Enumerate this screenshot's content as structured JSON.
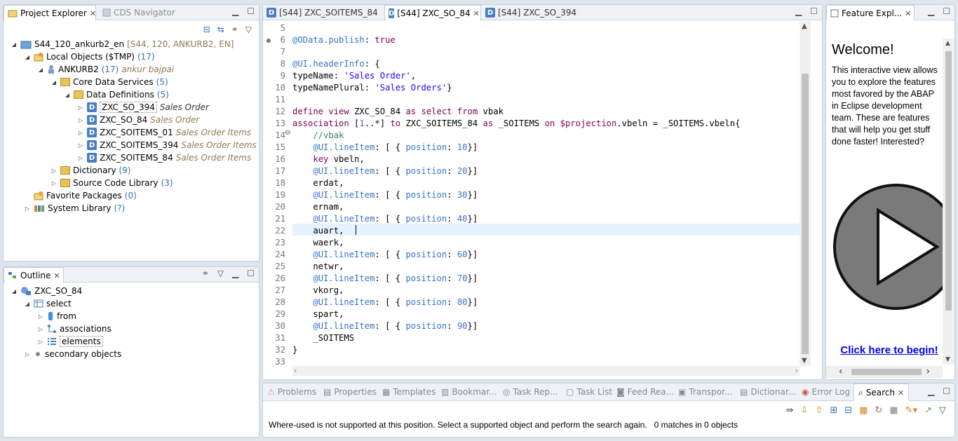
{
  "project_explorer": {
    "tabs": [
      {
        "label": "Project Explorer"
      },
      {
        "label": "CDS Navigator"
      }
    ],
    "tree": [
      {
        "label": "S44_120_ankurb2_en",
        "count": "[S44, 120, ANKURB2, EN]",
        "desc": ""
      },
      {
        "label": "Local Objects ($TMP)",
        "count": "(17)",
        "desc": ""
      },
      {
        "label": "ANKURB2",
        "count": "(17)",
        "desc": "ankur bajpai"
      },
      {
        "label": "Core Data Services",
        "count": "(5)",
        "desc": ""
      },
      {
        "label": "Data Definitions",
        "count": "(5)",
        "desc": ""
      },
      {
        "label": "ZXC_SO_394",
        "count": "",
        "desc": "Sales Order"
      },
      {
        "label": "ZXC_SO_84",
        "count": "",
        "desc": "Sales Order"
      },
      {
        "label": "ZXC_SOITEMS_01",
        "count": "",
        "desc": "Sales Order Items"
      },
      {
        "label": "ZXC_SOITEMS_394",
        "count": "",
        "desc": "Sales Order Items"
      },
      {
        "label": "ZXC_SOITEMS_84",
        "count": "",
        "desc": "Sales Order Items"
      },
      {
        "label": "Dictionary",
        "count": "(9)",
        "desc": ""
      },
      {
        "label": "Source Code Library",
        "count": "(3)",
        "desc": ""
      },
      {
        "label": "Favorite Packages",
        "count": "(0)",
        "desc": ""
      },
      {
        "label": "System Library",
        "count": "(?)",
        "desc": ""
      }
    ]
  },
  "outline": {
    "tab": "Outline",
    "tree": [
      {
        "label": "ZXC_SO_84"
      },
      {
        "label": "select"
      },
      {
        "label": "from"
      },
      {
        "label": "associations"
      },
      {
        "label": "elements"
      },
      {
        "label": "secondary objects"
      }
    ]
  },
  "editor": {
    "tabs": [
      {
        "label": "[S44] ZXC_SOITEMS_84"
      },
      {
        "label": "[S44] ZXC_SO_84"
      },
      {
        "label": "[S44] ZXC_SO_394"
      }
    ],
    "lines": [
      {
        "n": "5",
        "t": ""
      },
      {
        "n": "6",
        "t": "@OData.publish: true"
      },
      {
        "n": "7",
        "t": ""
      },
      {
        "n": "8",
        "t": "@UI.headerInfo: {"
      },
      {
        "n": "9",
        "t": "typeName: 'Sales Order',"
      },
      {
        "n": "10",
        "t": "typeNamePlural: 'Sales Orders'}"
      },
      {
        "n": "11",
        "t": ""
      },
      {
        "n": "12",
        "t": "define view ZXC_SO_84 as select from vbak"
      },
      {
        "n": "13",
        "t": "association [1..*] to ZXC_SOITEMS_84 as _SOITEMS on $projection.vbeln = _SOITEMS.vbeln{"
      },
      {
        "n": "14",
        "t": "    //vbak"
      },
      {
        "n": "15",
        "t": "    @UI.lineItem: [ { position: 10}]"
      },
      {
        "n": "16",
        "t": "    key vbeln,"
      },
      {
        "n": "17",
        "t": "    @UI.lineItem: [ { position: 20}]"
      },
      {
        "n": "18",
        "t": "    erdat,"
      },
      {
        "n": "19",
        "t": "    @UI.lineItem: [ { position: 30}]"
      },
      {
        "n": "20",
        "t": "    ernam,"
      },
      {
        "n": "21",
        "t": "    @UI.lineItem: [ { position: 40}]"
      },
      {
        "n": "22",
        "t": "    auart, "
      },
      {
        "n": "23",
        "t": "    waerk,"
      },
      {
        "n": "24",
        "t": "    @UI.lineItem: [ { position: 60}]"
      },
      {
        "n": "25",
        "t": "    netwr,"
      },
      {
        "n": "26",
        "t": "    @UI.lineItem: [ { position: 70}]"
      },
      {
        "n": "27",
        "t": "    vkorg,"
      },
      {
        "n": "28",
        "t": "    @UI.lineItem: [ { position: 80}]"
      },
      {
        "n": "29",
        "t": "    spart,"
      },
      {
        "n": "30",
        "t": "    @UI.lineItem: [ { position: 90}]"
      },
      {
        "n": "31",
        "t": "    _SOITEMS"
      },
      {
        "n": "32",
        "t": "}"
      },
      {
        "n": "33",
        "t": ""
      }
    ]
  },
  "feature_explorer": {
    "tab": "Feature Expl...",
    "heading": "Welcome!",
    "body": "This interactive view allows you to explore the features most favored by the ABAP in Eclipse development team. These are features that will help you get stuff done faster! Interested?",
    "link": "Click here to begin!"
  },
  "bottom": {
    "tabs": [
      {
        "label": "Problems"
      },
      {
        "label": "Properties"
      },
      {
        "label": "Templates"
      },
      {
        "label": "Bookmar..."
      },
      {
        "label": "Task Rep..."
      },
      {
        "label": "Task List"
      },
      {
        "label": "Feed Rea..."
      },
      {
        "label": "Transpor..."
      },
      {
        "label": "Dictionar..."
      },
      {
        "label": "Error Log"
      },
      {
        "label": "Search"
      }
    ],
    "status": "Where-used is not supported at this position. Select a supported object and perform the search again.   0 matches in 0 objects"
  },
  "colors": {
    "accent": "#3470b0",
    "keyword": "#7f0055",
    "annotation": "#3a73c9",
    "string": "#2a00ff",
    "comment": "#3f7f5f"
  }
}
